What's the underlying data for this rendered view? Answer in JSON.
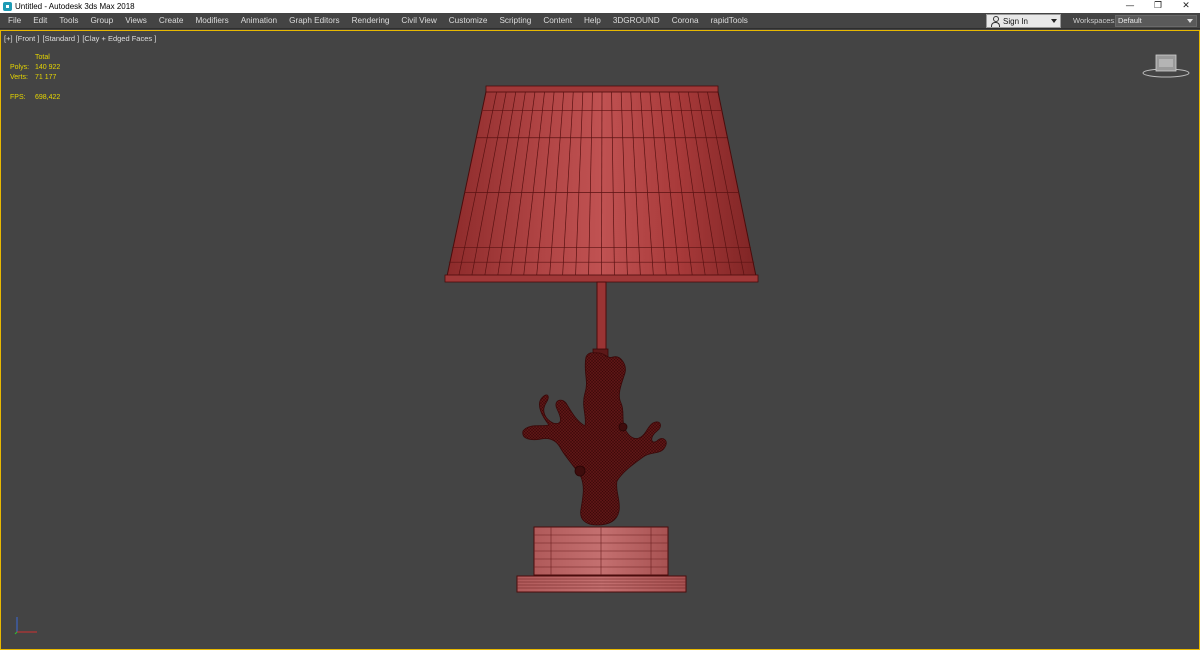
{
  "titlebar": {
    "title": "Untitled - Autodesk 3ds Max 2018",
    "minimize": "—",
    "restore": "❐",
    "close": "✕"
  },
  "menu": {
    "items": [
      "File",
      "Edit",
      "Tools",
      "Group",
      "Views",
      "Create",
      "Modifiers",
      "Animation",
      "Graph Editors",
      "Rendering",
      "Civil View",
      "Customize",
      "Scripting",
      "Content",
      "Help",
      "3DGROUND",
      "Corona",
      "rapidTools"
    ],
    "signin_label": "Sign In",
    "workspaces_label": "Workspaces:",
    "workspaces_value": "Default"
  },
  "viewport": {
    "labels": [
      "[+]",
      "[Front ]",
      "[Standard ]",
      "[Clay + Edged Faces ]"
    ],
    "stats": {
      "header": "Total",
      "polys_label": "Polys:",
      "polys_value": "140 922",
      "verts_label": "Verts:",
      "verts_value": "71 177",
      "fps_label": "FPS:",
      "fps_value": "698,422"
    },
    "viewcube_icon": "viewcube-icon",
    "axis_icon": "axis-tripod-icon"
  },
  "colors": {
    "viewport_bg": "#444444",
    "active_border": "#e8b800",
    "stats_text": "#e6d600",
    "mesh_fill": "#a83a3a",
    "wire": "#4a0c0c"
  }
}
